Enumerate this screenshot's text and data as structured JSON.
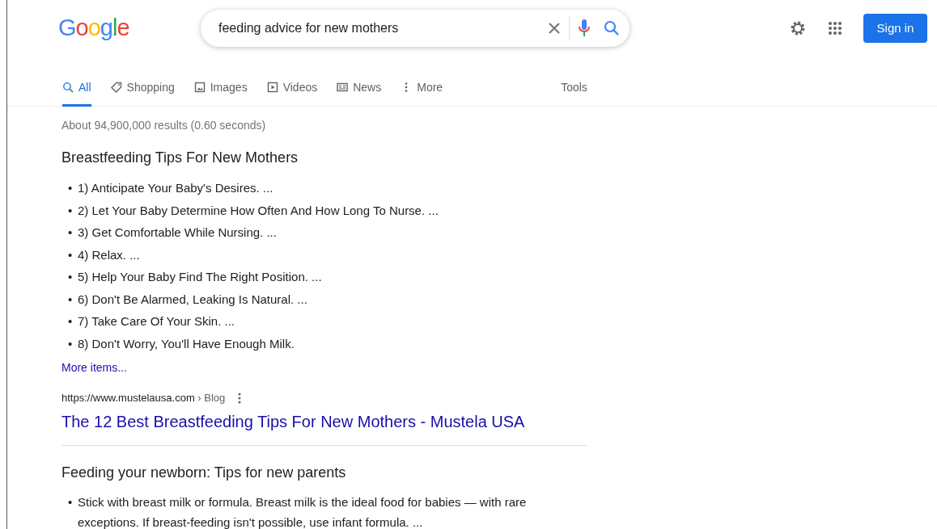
{
  "logo": "Google",
  "search": {
    "value": "feeding advice for new mothers"
  },
  "header_buttons": {
    "sign_in": "Sign in"
  },
  "tabs": [
    {
      "label": "All",
      "kind": "search",
      "selected": true
    },
    {
      "label": "Shopping",
      "kind": "tag",
      "selected": false
    },
    {
      "label": "Images",
      "kind": "image",
      "selected": false
    },
    {
      "label": "Videos",
      "kind": "play",
      "selected": false
    },
    {
      "label": "News",
      "kind": "news",
      "selected": false
    },
    {
      "label": "More",
      "kind": "dots",
      "selected": false
    }
  ],
  "bullet": "•",
  "tools": "Tools",
  "result_stats": "About 94,900,000 results (0.60 seconds)",
  "snippet": {
    "title": "Breastfeeding Tips For New Mothers",
    "items": [
      "1) Anticipate Your Baby's Desires. ...",
      "2) Let Your Baby Determine How Often And How Long To Nurse. ...",
      "3) Get Comfortable While Nursing. ...",
      "4) Relax. ...",
      "5) Help Your Baby Find The Right Position. ...",
      "6) Don't Be Alarmed, Leaking Is Natural. ...",
      "7) Take Care Of Your Skin. ...",
      "8) Don't Worry, You'll Have Enough Milk."
    ],
    "more": "More items...",
    "url": "https://www.mustelausa.com",
    "breadcrumb": "› Blog",
    "link": "The 12 Best Breastfeeding Tips For New Mothers - Mustela USA"
  },
  "snippet2": {
    "title": "Feeding your newborn: Tips for new parents",
    "items": [
      "Stick with breast milk or formula. Breast milk is the ideal food for babies — with rare exceptions. If breast-feeding isn't possible, use infant formula. ..."
    ]
  }
}
